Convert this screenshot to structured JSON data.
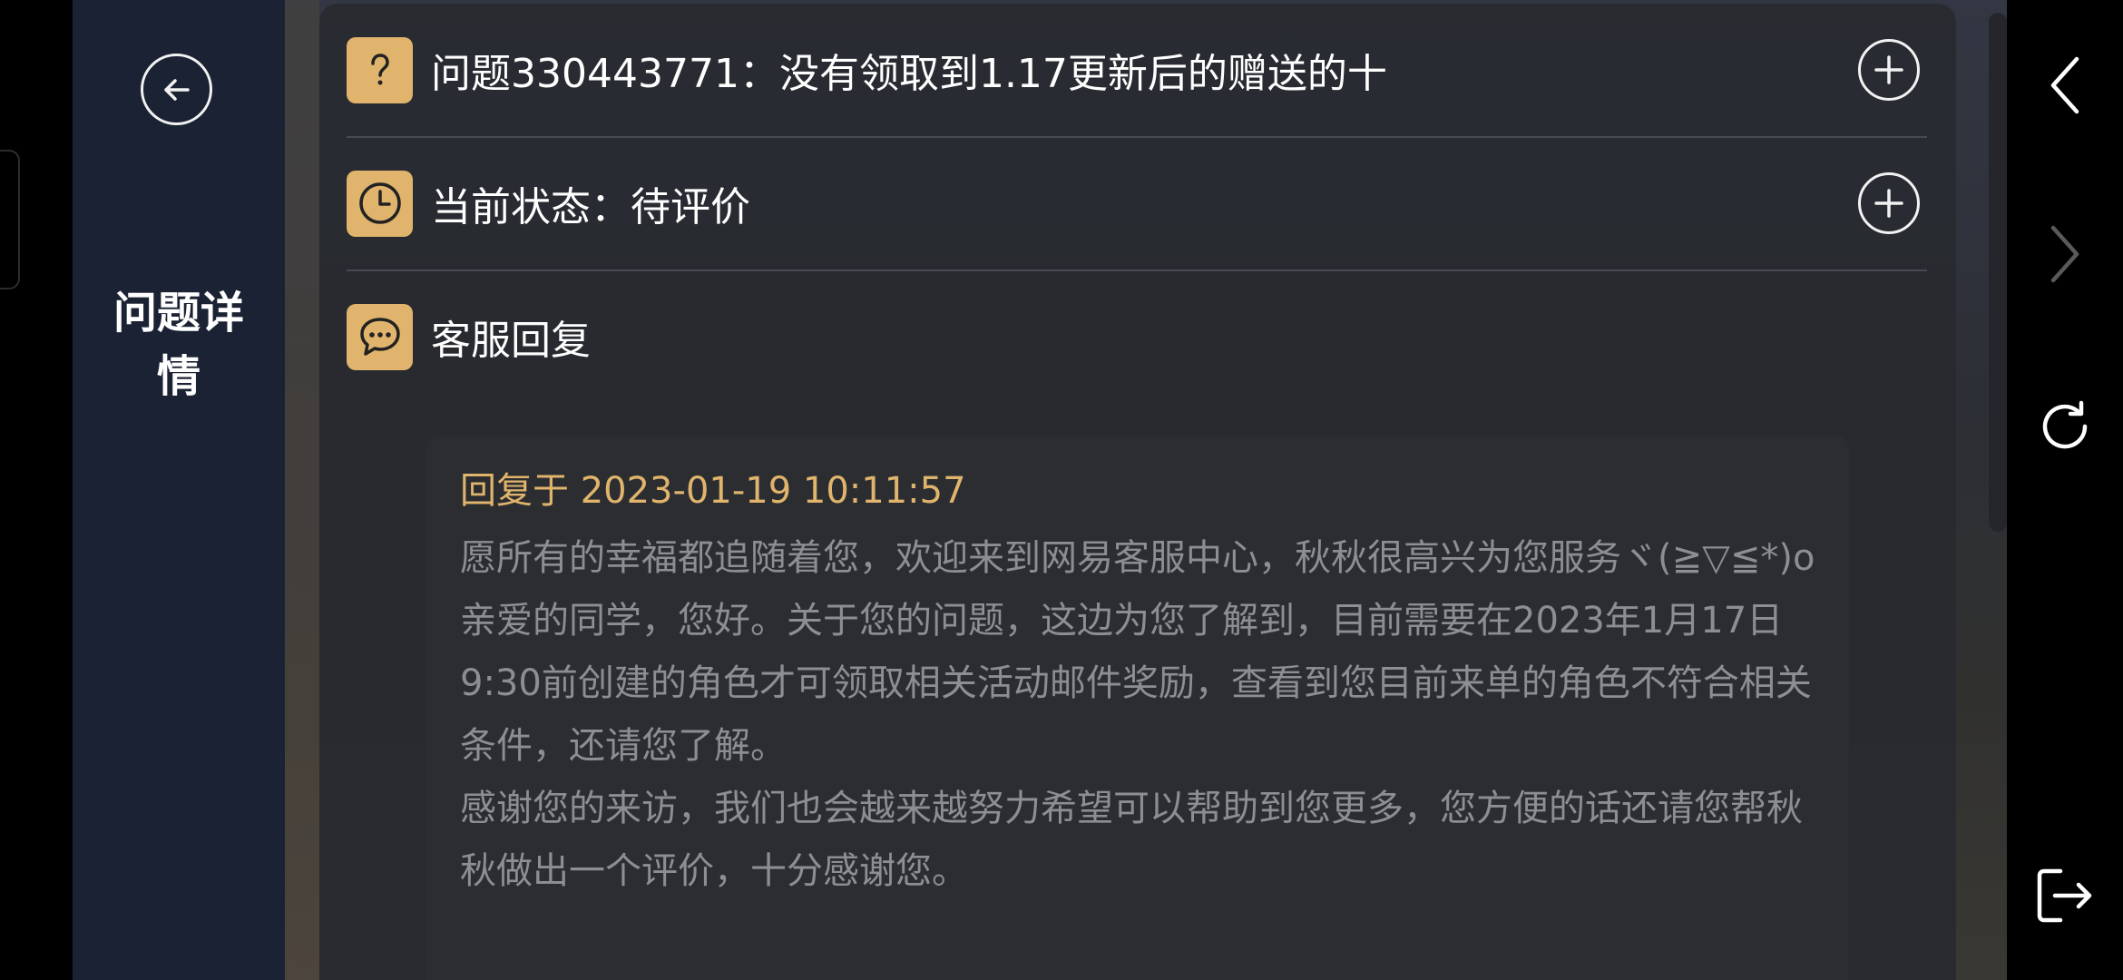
{
  "sidebar": {
    "title": "问题详情"
  },
  "question": {
    "text": "问题330443771：没有领取到1.17更新后的赠送的十",
    "icon": "question-icon"
  },
  "status": {
    "text": "当前状态：待评价",
    "icon": "clock-icon"
  },
  "reply_section": {
    "label": "客服回复",
    "icon": "chat-bubble-icon",
    "time": "回复于 2023-01-19 10:11:57",
    "paragraphs": [
      "愿所有的幸福都追随着您，欢迎来到网易客服中心，秋秋很高兴为您服务ヾ(≧▽≦*)o",
      "亲爱的同学，您好。关于您的问题，这边为您了解到，目前需要在2023年1月17日9:30前创建的角色才可领取相关活动邮件奖励，查看到您目前来单的角色不符合相关条件，还请您了解。",
      "感谢您的来访，我们也会越来越努力希望可以帮助到您更多，您方便的话还请您帮秋秋做出一个评价，十分感谢您。"
    ]
  },
  "colors": {
    "accent": "#e0b46c",
    "sidebar_bg": "#1a2233",
    "panel_bg": "#2a2c32",
    "body_text": "#8d8e93"
  },
  "nav_icons": [
    "chevron-left-icon",
    "chevron-right-icon",
    "refresh-icon",
    "exit-icon"
  ]
}
